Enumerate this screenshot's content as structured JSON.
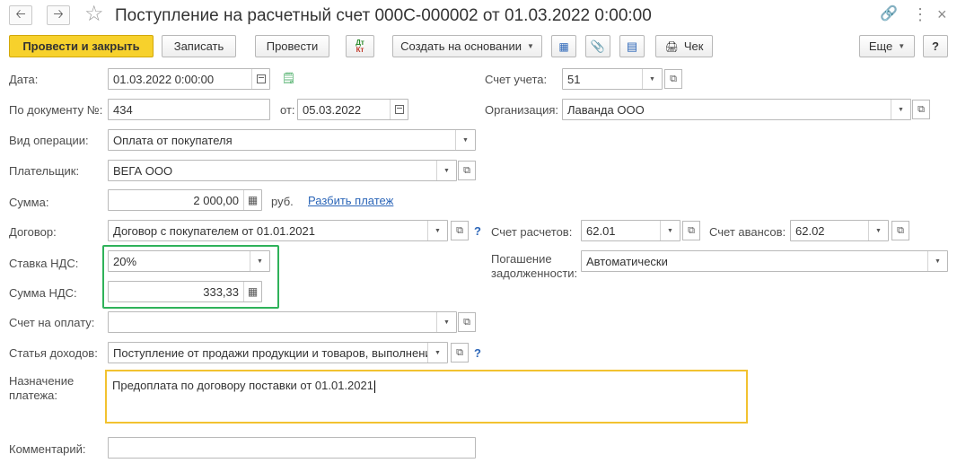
{
  "window": {
    "title": "Поступление на расчетный счет 000С-000002 от 01.03.2022 0:00:00",
    "back_icon": "arrow-left",
    "forward_icon": "arrow-right",
    "favorite_icon": "star",
    "link_icon": "link",
    "more_icon": "vertical-dots",
    "close_icon": "close"
  },
  "toolbar": {
    "post_close": "Провести и закрыть",
    "save": "Записать",
    "post": "Провести",
    "dtkt_top": "Дт",
    "dtkt_bottom": "Кт",
    "create_based": "Создать на основании",
    "check": "Чек",
    "more": "Еще",
    "help": "?"
  },
  "form": {
    "date": {
      "label": "Дата:",
      "value": "01.03.2022  0:00:00"
    },
    "account": {
      "label": "Счет учета:",
      "value": "51"
    },
    "doc_number": {
      "label": "По документу №:",
      "value": "434"
    },
    "doc_date": {
      "label": "от:",
      "value": "05.03.2022"
    },
    "organization": {
      "label": "Организация:",
      "value": "Лаванда ООО"
    },
    "operation": {
      "label": "Вид операции:",
      "value": "Оплата от покупателя"
    },
    "payer": {
      "label": "Плательщик:",
      "value": "ВЕГА ООО"
    },
    "amount": {
      "label": "Сумма:",
      "value": "2 000,00",
      "currency": "руб.",
      "split_link": "Разбить платеж"
    },
    "contract": {
      "label": "Договор:",
      "value": "Договор с покупателем от 01.01.2021",
      "help": "?"
    },
    "settlement_account": {
      "label": "Счет расчетов:",
      "value": "62.01"
    },
    "advance_account": {
      "label": "Счет авансов:",
      "value": "62.02"
    },
    "vat_rate": {
      "label": "Ставка НДС:",
      "value": "20%"
    },
    "debt_repayment": {
      "label_line1": "Погашение",
      "label_line2": "задолженности:",
      "value": "Автоматически"
    },
    "vat_amount": {
      "label": "Сумма НДС:",
      "value": "333,33"
    },
    "invoice": {
      "label": "Счет на оплату:",
      "value": ""
    },
    "income_item": {
      "label": "Статья доходов:",
      "value": "Поступление от продажи продукции и товаров, выполнения",
      "help": "?"
    },
    "purpose": {
      "label_line1": "Назначение",
      "label_line2": "платежа:",
      "value": "Предоплата по договору поставки от 01.01.2021"
    },
    "comment": {
      "label": "Комментарий:",
      "value": ""
    }
  },
  "colors": {
    "primary_button": "#f7d12c",
    "highlight_green": "#2fb25a",
    "highlight_yellow": "#f2c230",
    "link": "#2c66b8"
  }
}
